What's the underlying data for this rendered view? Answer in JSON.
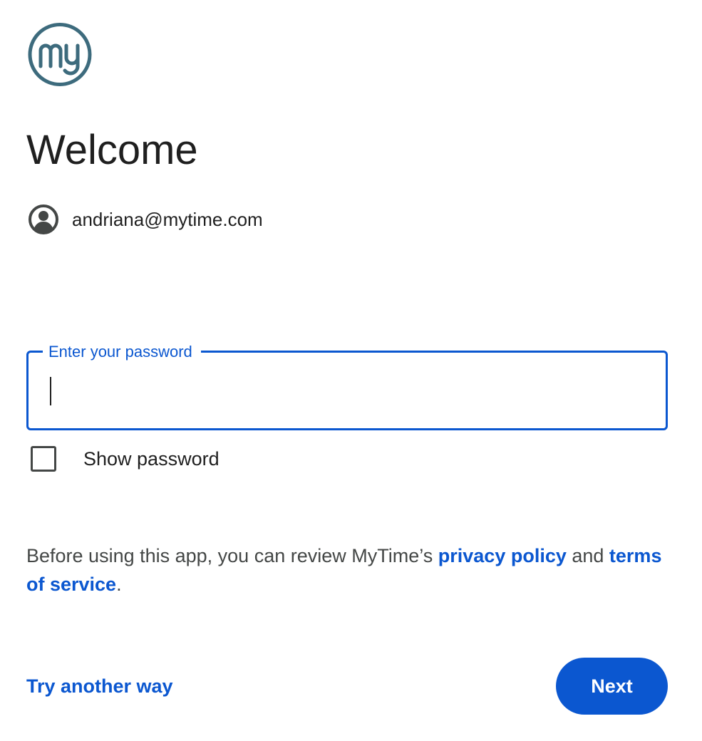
{
  "logo": {
    "text": "my",
    "icon": "mytime-logo-icon",
    "color": "#3d6b7d"
  },
  "header": {
    "title": "Welcome"
  },
  "account": {
    "icon": "account-circle-icon",
    "email": "andriana@mytime.com"
  },
  "password": {
    "label": "Enter your password",
    "value": ""
  },
  "show_password": {
    "label": "Show password",
    "checked": false
  },
  "privacy": {
    "prefix": "Before using this app, you can review MyTime’s ",
    "privacy_link": "privacy policy",
    "middle": " and ",
    "terms_link": "terms of service",
    "suffix": "."
  },
  "actions": {
    "try_another": "Try another way",
    "next": "Next"
  },
  "colors": {
    "accent": "#0b57d0",
    "text": "#1f1f1f",
    "secondary_text": "#444746"
  }
}
